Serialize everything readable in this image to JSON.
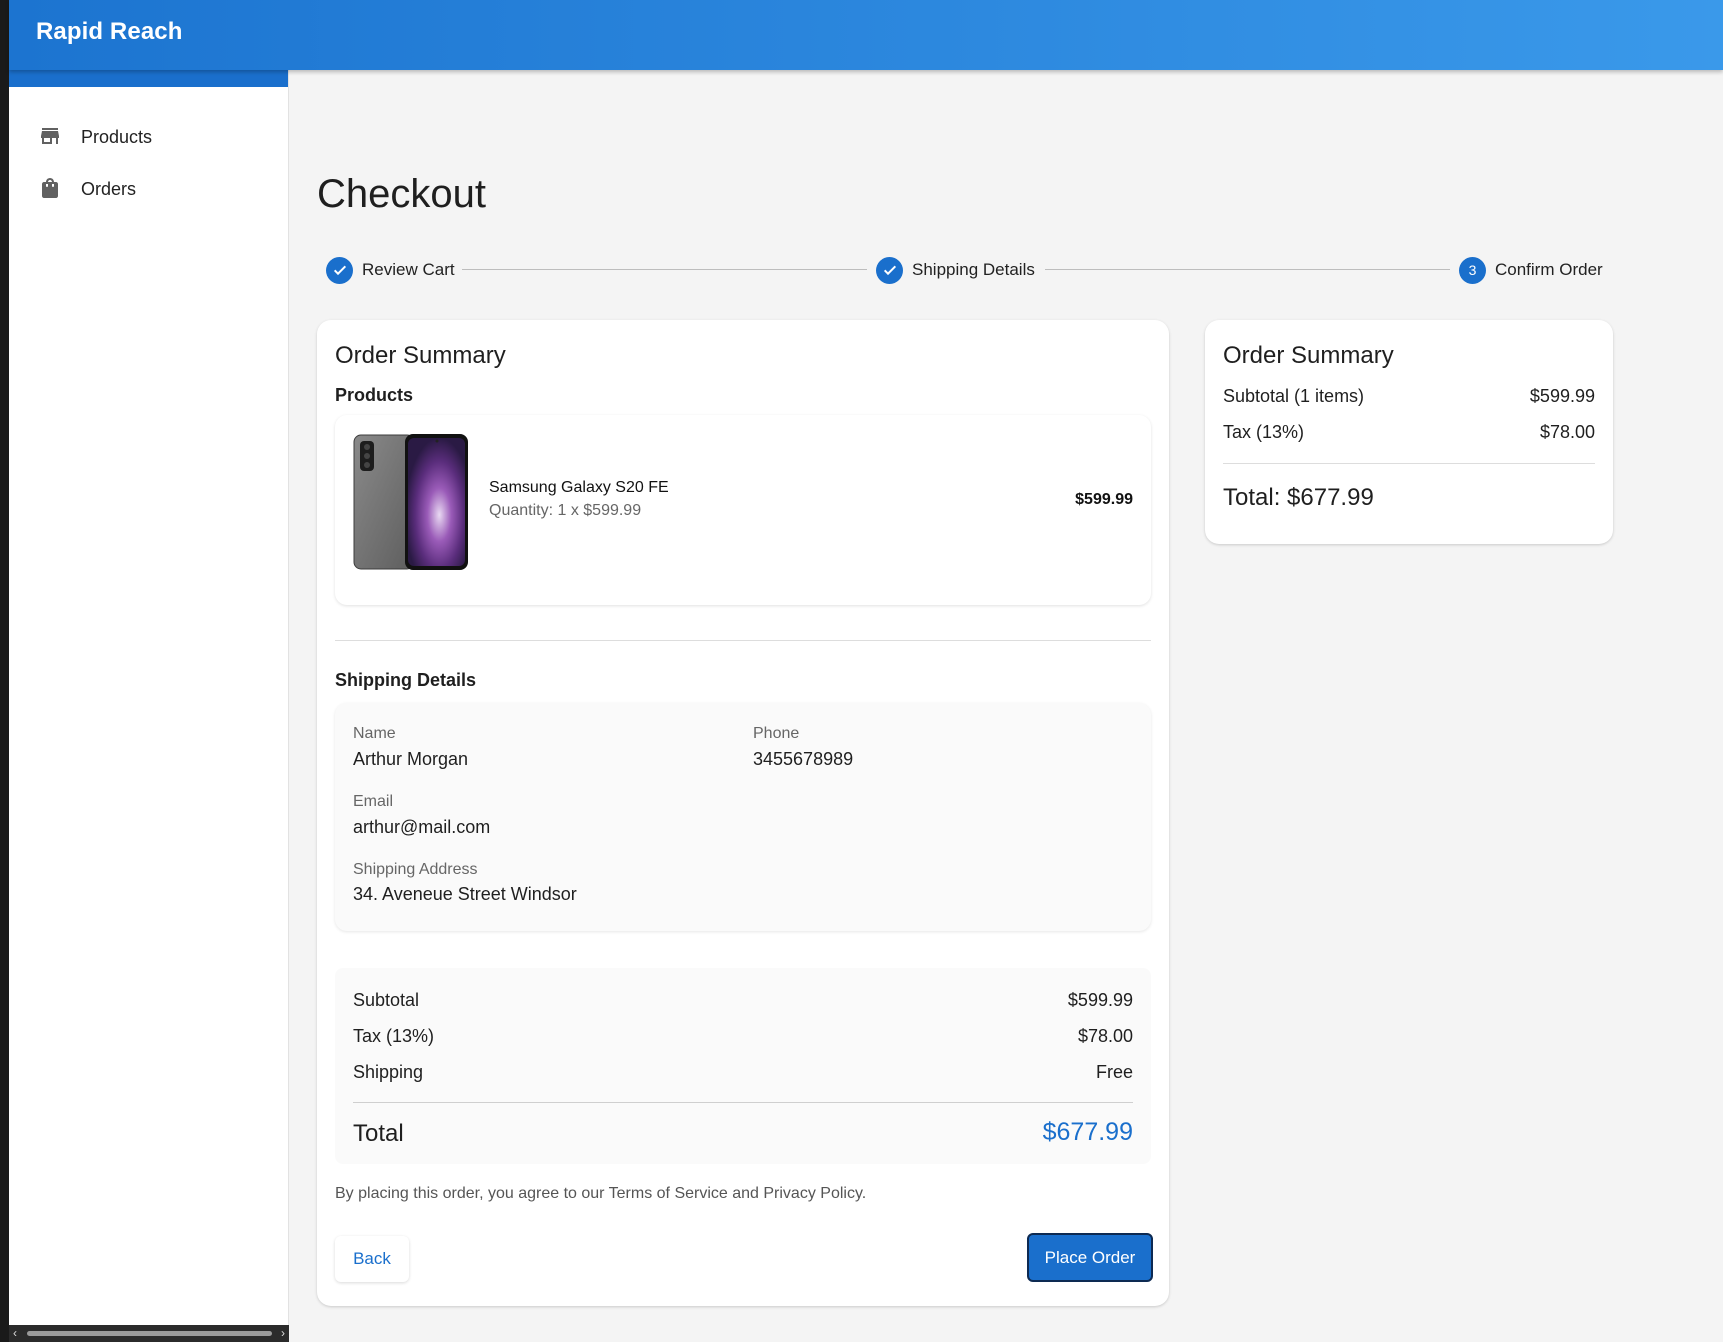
{
  "app": {
    "title": "Rapid Reach"
  },
  "sidebar": {
    "items": [
      {
        "label": "Products",
        "icon": "store-icon"
      },
      {
        "label": "Orders",
        "icon": "shopping-bag-icon"
      }
    ]
  },
  "page": {
    "title": "Checkout"
  },
  "stepper": {
    "steps": [
      {
        "label": "Review Cart",
        "state": "completed"
      },
      {
        "label": "Shipping Details",
        "state": "completed"
      },
      {
        "label": "Confirm Order",
        "state": "active",
        "number": "3"
      }
    ]
  },
  "main": {
    "title": "Order Summary",
    "products_heading": "Products",
    "product": {
      "name": "Samsung Galaxy S20 FE",
      "quantity_text": "Quantity: 1 x $599.99",
      "price": "$599.99"
    },
    "shipping_heading": "Shipping Details",
    "shipping": {
      "name_label": "Name",
      "name_value": "Arthur Morgan",
      "phone_label": "Phone",
      "phone_value": "3455678989",
      "email_label": "Email",
      "email_value": "arthur@mail.com",
      "address_label": "Shipping Address",
      "address_value": "34. Aveneue Street Windsor"
    },
    "totals": {
      "subtotal_label": "Subtotal",
      "subtotal_value": "$599.99",
      "tax_label": "Tax (13%)",
      "tax_value": "$78.00",
      "shipping_label": "Shipping",
      "shipping_value": "Free",
      "total_label": "Total",
      "total_value": "$677.99"
    },
    "terms": "By placing this order, you agree to our Terms of Service and Privacy Policy.",
    "back_label": "Back",
    "place_order_label": "Place Order"
  },
  "side_summary": {
    "title": "Order Summary",
    "subtotal_label": "Subtotal (1 items)",
    "subtotal_value": "$599.99",
    "tax_label": "Tax (13%)",
    "tax_value": "$78.00",
    "total_text": "Total: $677.99"
  },
  "colors": {
    "primary": "#1a6fcc",
    "appbar_start": "#1c74d0",
    "appbar_end": "#3a99ea"
  }
}
